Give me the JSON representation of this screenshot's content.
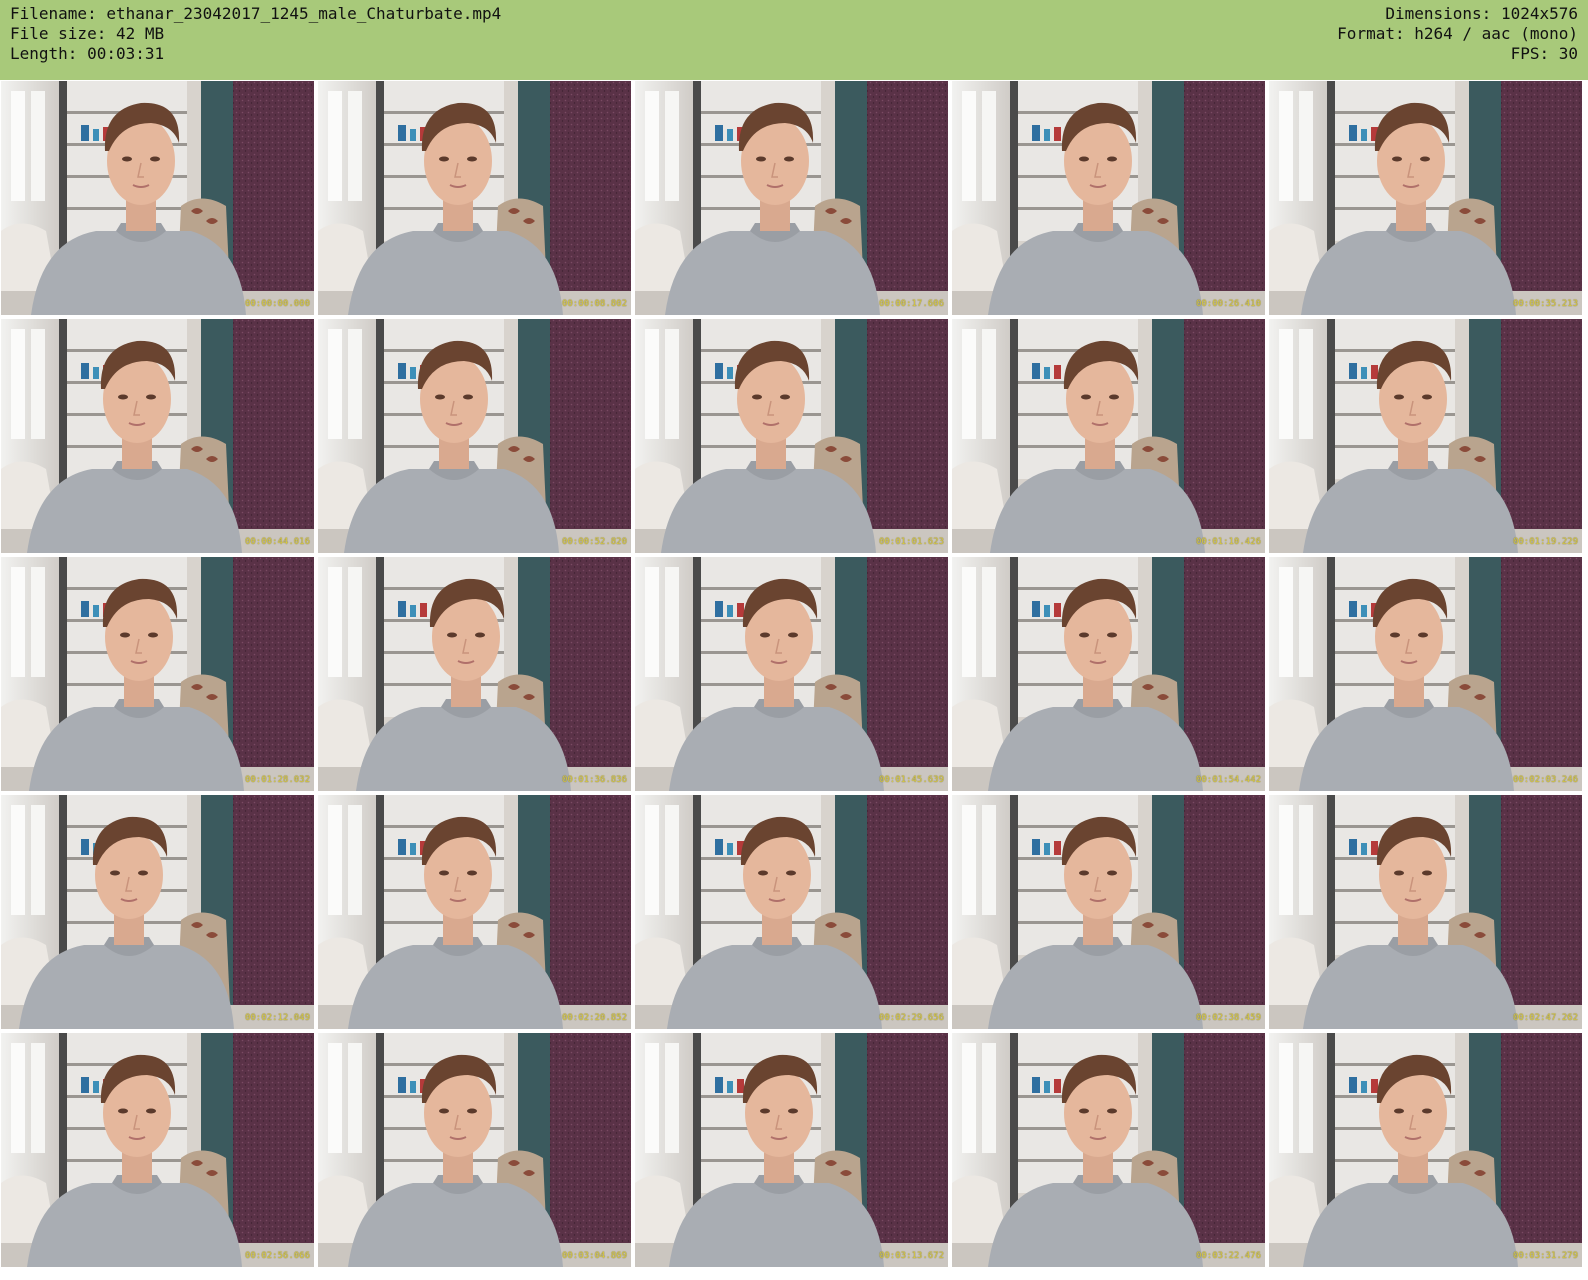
{
  "header": {
    "filename": "Filename: ethanar_23042017_1245_male_Chaturbate.mp4",
    "filesize": "File size: 42 MB",
    "length": "Length: 00:03:31",
    "dimensions": "Dimensions: 1024x576",
    "format": "Format: h264 / aac (mono)",
    "fps": "FPS: 30",
    "background_color": "#a8c97a"
  },
  "thumbnails": [
    {
      "timestamp": "00:00:00.000"
    },
    {
      "timestamp": "00:00:08.802"
    },
    {
      "timestamp": "00:00:17.606"
    },
    {
      "timestamp": "00:00:26.410"
    },
    {
      "timestamp": "00:00:35.213"
    },
    {
      "timestamp": "00:00:44.016"
    },
    {
      "timestamp": "00:00:52.820"
    },
    {
      "timestamp": "00:01:01.623"
    },
    {
      "timestamp": "00:01:10.426"
    },
    {
      "timestamp": "00:01:19.229"
    },
    {
      "timestamp": "00:01:28.032"
    },
    {
      "timestamp": "00:01:36.836"
    },
    {
      "timestamp": "00:01:45.639"
    },
    {
      "timestamp": "00:01:54.442"
    },
    {
      "timestamp": "00:02:03.246"
    },
    {
      "timestamp": "00:02:12.049"
    },
    {
      "timestamp": "00:02:20.852"
    },
    {
      "timestamp": "00:02:29.656"
    },
    {
      "timestamp": "00:02:38.459"
    },
    {
      "timestamp": "00:02:47.262"
    },
    {
      "timestamp": "00:02:56.066"
    },
    {
      "timestamp": "00:03:04.869"
    },
    {
      "timestamp": "00:03:13.672"
    },
    {
      "timestamp": "00:03:22.476"
    },
    {
      "timestamp": "00:03:31.279"
    }
  ],
  "grid": {
    "columns": 5,
    "rows": 5
  }
}
